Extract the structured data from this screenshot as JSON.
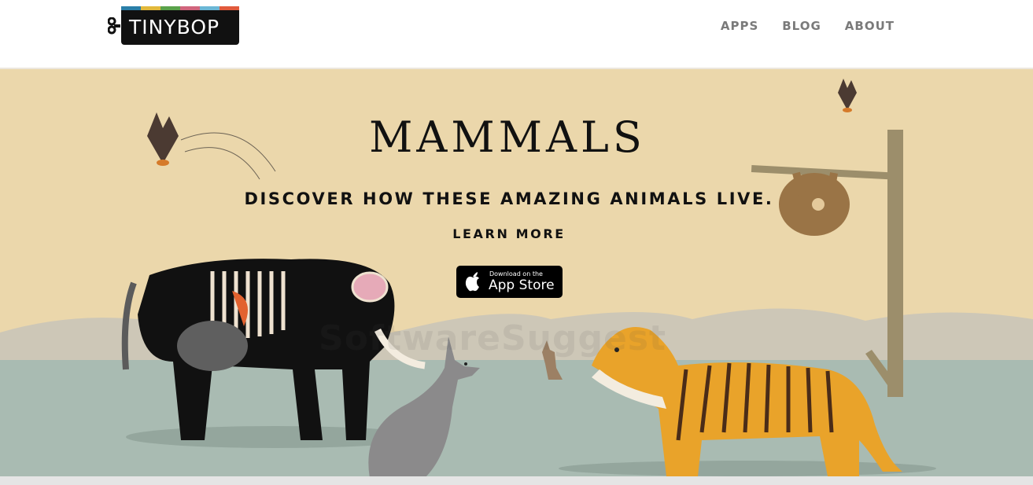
{
  "header": {
    "logo_text": "TINYBOP",
    "logo_stripe_colors": [
      "#2a7fa8",
      "#e2b93b",
      "#5aa24b",
      "#d1657d",
      "#6bb7d6",
      "#e15a3c"
    ],
    "nav": [
      {
        "label": "APPS"
      },
      {
        "label": "BLOG"
      },
      {
        "label": "ABOUT"
      }
    ]
  },
  "hero": {
    "title": "MAMMALS",
    "subtitle": "DISCOVER HOW THESE AMAZING ANIMALS LIVE.",
    "cta": "LEARN MORE",
    "appstore_small": "Download on the",
    "appstore_big": "App Store",
    "watermark": "SoftwareSuggest"
  },
  "colors": {
    "sky": "#ebd7ab",
    "hills": "#cdc7b7",
    "ground": "#a9bbb2",
    "tiger": "#e9a32a"
  }
}
